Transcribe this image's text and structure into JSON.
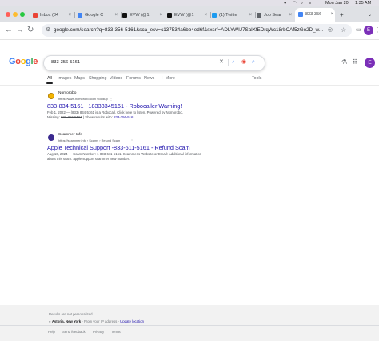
{
  "menubar": {
    "date": "Mon Jan 20",
    "time": "1:35 AM"
  },
  "colors": {
    "traffic_red": "#ff5f57",
    "traffic_yellow": "#febc2e",
    "traffic_green": "#28c840",
    "link_blue": "#1a0dab",
    "avatar_purple": "#7b2fb8"
  },
  "tabs": [
    {
      "label": "Inbox (84",
      "icon": "gmail-icon"
    },
    {
      "label": "Google C",
      "icon": "google-icon"
    },
    {
      "label": "EVW (@1",
      "icon": "x-icon"
    },
    {
      "label": "EVW (@1",
      "icon": "x-icon"
    },
    {
      "label": "(1) Twitte",
      "icon": "twitter-icon"
    },
    {
      "label": "Job Sear",
      "icon": "search-icon"
    },
    {
      "label": "833-356",
      "icon": "google-icon"
    }
  ],
  "toolbar": {
    "url": "google.com/search?q=833-356-5161&sca_esv=c137534a6bb4ed6f&sxsrf=ADLYWIJ7SalXfEDrqWc18rbCAf5zGo2D_w...",
    "profile_initial": "E"
  },
  "search": {
    "query": "833-356-5161",
    "avatar_initial": "E",
    "tabs": [
      "All",
      "Images",
      "Maps",
      "Shopping",
      "Videos",
      "Forums",
      "News",
      "More"
    ],
    "more_prefix": "⋮",
    "tools": "Tools"
  },
  "results": [
    {
      "site_name": "Nomorobo",
      "site_url": "https://www.nomorobo.com › lookup",
      "title": "833-834-5161 | 18338345161 - Robocaller Warning!",
      "snippet_line1": "Feb 1, 2022 — (833) 834-5161 is a Robocall. Click here to listen. Powered by Nomorobo.",
      "missing_label": "Missing:",
      "missing_struck": "833-356-5161",
      "show_results_prefix": "| Show results with:",
      "show_results_term": "833-356-5161"
    },
    {
      "site_name": "Scammer Info",
      "site_url": "https://scammer.info › Scams › Refund Scam",
      "title": "Apple Technical Support -833-611-5161 - Refund Scam",
      "snippet_line1": "Aug 16, 2024 — Scam Number: 1-833-611-5161. Scammer's Website or Email: Additional information",
      "snippet_line2": "about this scam: apple support scammer new number."
    }
  ],
  "footer": {
    "personalized": "Results are not personalized",
    "location_name": "Astoria, New York",
    "location_from": "- From your IP address",
    "location_sep": "-",
    "update_location": "Update location",
    "links": [
      "Help",
      "Send feedback",
      "Privacy",
      "Terms"
    ]
  }
}
